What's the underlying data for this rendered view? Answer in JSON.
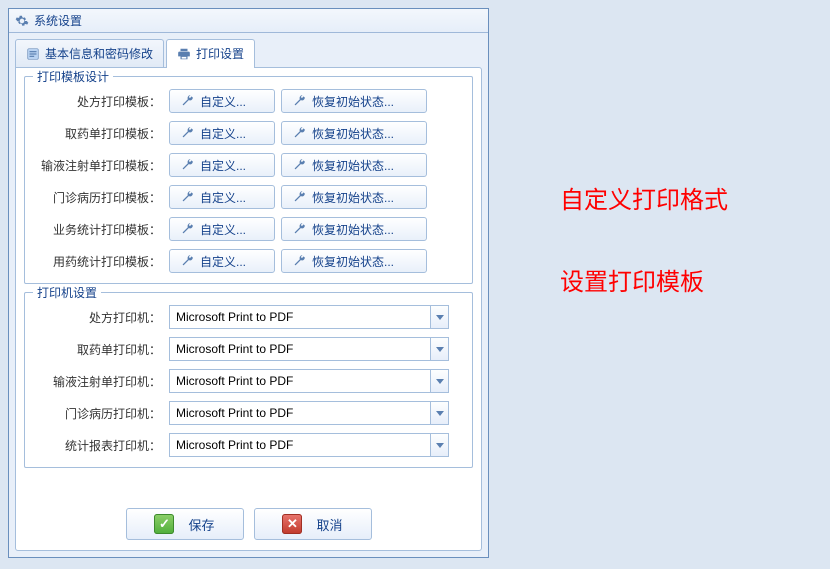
{
  "window": {
    "title": "系统设置"
  },
  "tabs": {
    "basic": "基本信息和密码修改",
    "print": "打印设置"
  },
  "templates": {
    "legend": "打印模板设计",
    "custom_btn": "自定义...",
    "reset_btn": "恢复初始状态...",
    "rows": [
      "处方打印模板：",
      "取药单打印模板：",
      "输液注射单打印模板：",
      "门诊病历打印模板：",
      "业务统计打印模板：",
      "用药统计打印模板："
    ]
  },
  "printers": {
    "legend": "打印机设置",
    "default_printer": "Microsoft Print to PDF",
    "rows": [
      "处方打印机：",
      "取药单打印机：",
      "输液注射单打印机：",
      "门诊病历打印机：",
      "统计报表打印机："
    ]
  },
  "footer": {
    "save": "保存",
    "cancel": "取消"
  },
  "annotations": {
    "line1": "自定义打印格式",
    "line2": "设置打印模板"
  }
}
